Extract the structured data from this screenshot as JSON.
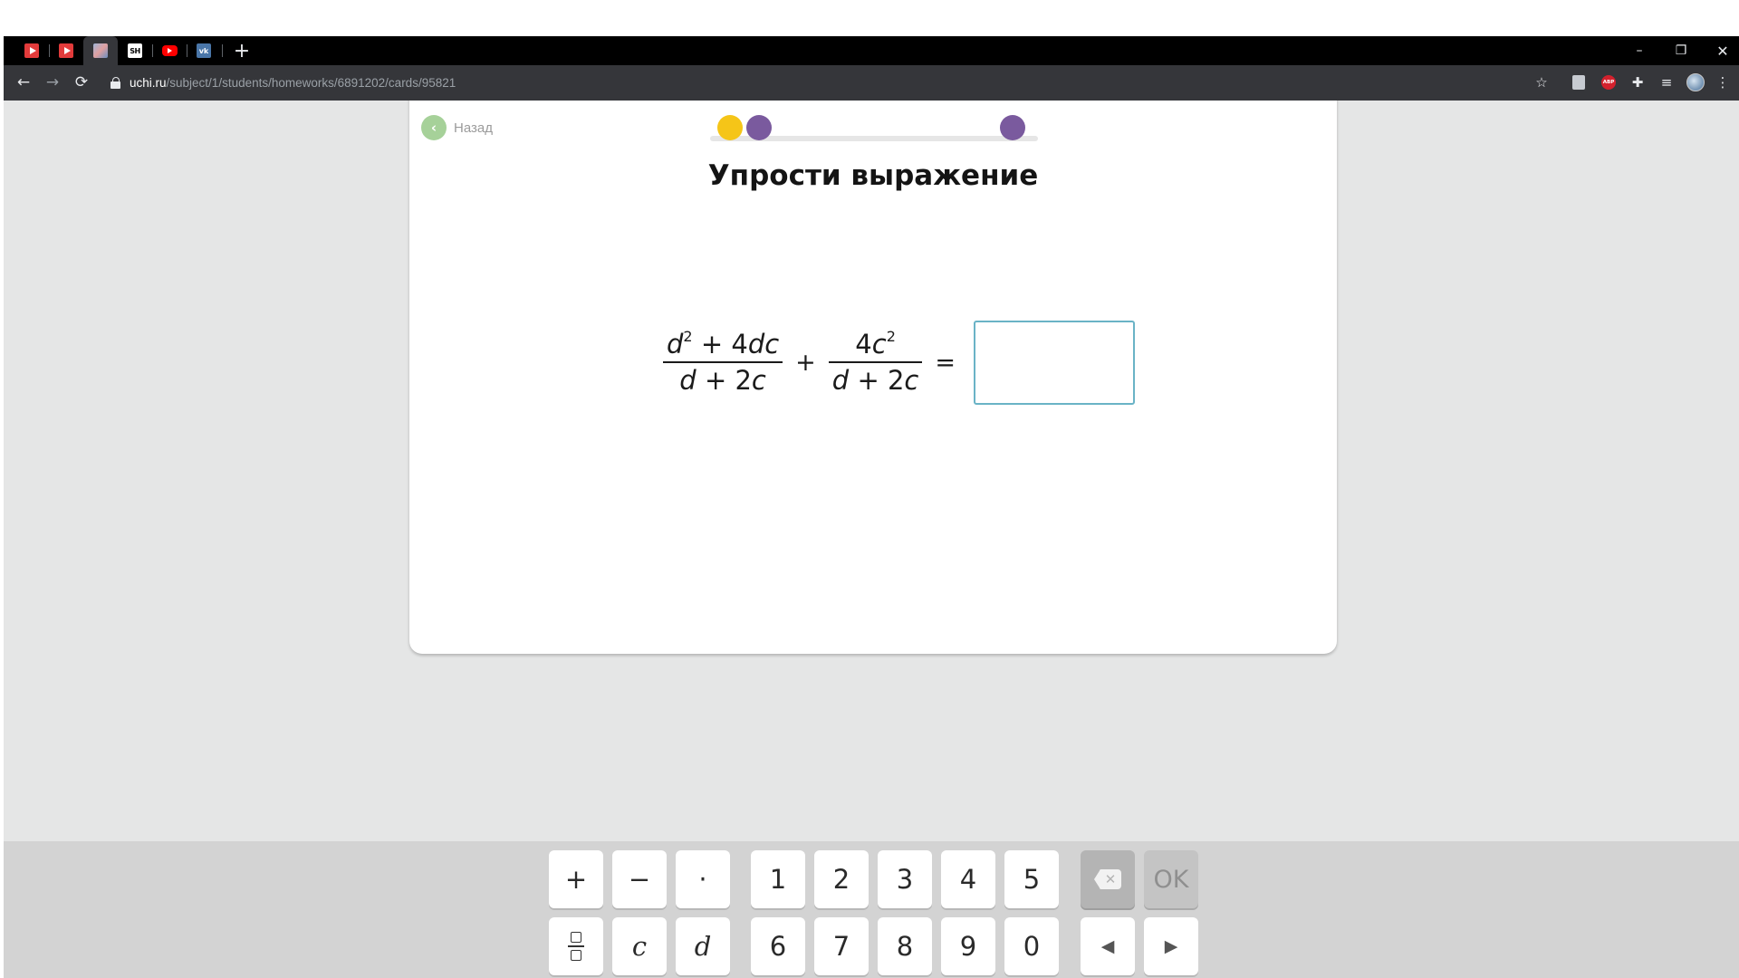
{
  "browser": {
    "tabs": [
      {
        "icon": "red-play-icon"
      },
      {
        "icon": "red-play-icon"
      },
      {
        "icon": "image-favicon-icon",
        "active": true
      },
      {
        "icon": "sh-favicon-icon",
        "text": "SH"
      },
      {
        "icon": "youtube-icon"
      },
      {
        "icon": "vk-icon",
        "text": "vk"
      }
    ],
    "new_tab_glyph": "+",
    "window_controls": {
      "minimize": "–",
      "restore": "❐",
      "close": "✕"
    },
    "nav": {
      "back": "←",
      "forward": "→",
      "reload": "⟳"
    },
    "url": {
      "domain": "uchi.ru",
      "path": "/subject/1/students/homeworks/6891202/cards/95821"
    },
    "toolbar_glyphs": {
      "star": "☆",
      "puzzle": "✚",
      "playlist": "≡",
      "menu": "⋮",
      "abp": "ABP"
    }
  },
  "card": {
    "back_label": "Назад",
    "progress": {
      "dots": [
        {
          "state": "current",
          "color": "#f5c518"
        },
        {
          "state": "pending",
          "color": "#7a5a9e"
        },
        {
          "state": "pending",
          "color": "#7a5a9e"
        }
      ]
    },
    "title": "Упрости выражение",
    "expression": {
      "fraction1": {
        "numerator": [
          "d",
          "2",
          "+",
          "4",
          "dc"
        ],
        "denominator": [
          "d",
          "+",
          "2",
          "c"
        ]
      },
      "operator": "+",
      "fraction2": {
        "numerator": [
          "4",
          "c",
          "2"
        ],
        "denominator": [
          "d",
          "+",
          "2",
          "c"
        ]
      },
      "equals": "=",
      "answer_value": ""
    }
  },
  "keyboard": {
    "row1": [
      "+",
      "−",
      "·",
      "1",
      "2",
      "3",
      "4",
      "5"
    ],
    "row2": [
      "c",
      "d",
      "6",
      "7",
      "8",
      "9",
      "0"
    ],
    "ok_label": "OK",
    "left_arrow": "◀",
    "right_arrow": "▶"
  },
  "colors": {
    "accent": "#6ab3c6",
    "back_green": "#a6d199",
    "progress_yellow": "#f5c518",
    "progress_purple": "#7a5a9e"
  }
}
